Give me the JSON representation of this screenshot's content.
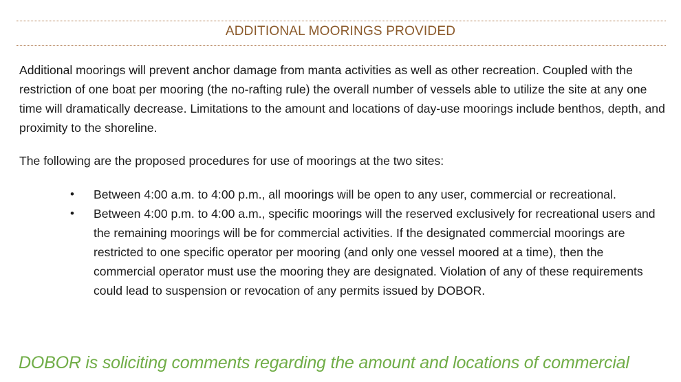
{
  "section": {
    "heading": "ADDITIONAL MOORINGS PROVIDED",
    "colors": {
      "heading": "#8b5a2b",
      "rule": "#b07a4f",
      "body_text": "#1b1b1b",
      "callout": "#70ad47"
    }
  },
  "paragraphs": [
    "Additional moorings will prevent anchor damage from manta activities as well as other recreation. Coupled with the restriction of one boat per mooring (the no-rafting rule) the overall number of vessels able to utilize the site at any one time will dramatically decrease. Limitations to the amount and locations of day-use moorings include benthos, depth, and proximity to the shoreline.",
    "The following are the proposed procedures for use of moorings at the two sites:"
  ],
  "procedures": [
    {
      "bullet": "•",
      "text": "Between 4:00 a.m. to 4:00 p.m., all moorings will be open to any user, commercial or recreational."
    },
    {
      "bullet": "•",
      "text": "Between 4:00 p.m. to 4:00 a.m., specific moorings will the reserved exclusively for recreational users and the remaining moorings will be for commercial activities.  If the designated commercial moorings are restricted to one specific operator per mooring (and only one vessel moored at a time), then the commercial operator must use the mooring they are designated.  Violation of any of these requirements could lead to suspension or revocation of any permits issued by DOBOR."
    }
  ],
  "callout": "DOBOR is soliciting comments regarding the amount and locations of commercial"
}
